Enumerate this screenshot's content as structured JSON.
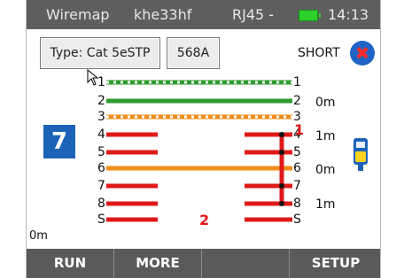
{
  "status_bar": {
    "title": "Wiremap",
    "device": "khe33hf",
    "connector": "RJ45 -",
    "time": "14:13",
    "battery_color": "#2ccf2c"
  },
  "header": {
    "type_button_label": "Type: Cat 5eSTP",
    "scheme_button_label": "568A",
    "result_label": "SHORT",
    "result_icon": "close-circle-icon",
    "result_icon_glyph": "✖"
  },
  "wiremap": {
    "pair_count": "7",
    "left_distance": "0m",
    "remote_icon": "remote-unit-icon",
    "pins_left": [
      "1",
      "2",
      "3",
      "4",
      "5",
      "6",
      "7",
      "8",
      "S"
    ],
    "pins_right": [
      "1",
      "2",
      "3",
      "4",
      "5",
      "6",
      "7",
      "8",
      "S"
    ],
    "wires": [
      {
        "pin": "1",
        "color": "#2e9b2e",
        "style": "dashed-white",
        "status": "ok"
      },
      {
        "pin": "2",
        "color": "#2e9b2e",
        "style": "solid",
        "status": "ok"
      },
      {
        "pin": "3",
        "color": "#f08c1a",
        "style": "dashed-white",
        "status": "ok"
      },
      {
        "pin": "4",
        "color": "#e01818",
        "style": "split",
        "status": "short"
      },
      {
        "pin": "5",
        "color": "#e01818",
        "style": "split",
        "status": "short"
      },
      {
        "pin": "6",
        "color": "#f08c1a",
        "style": "solid",
        "status": "ok"
      },
      {
        "pin": "7",
        "color": "#e01818",
        "style": "split",
        "status": "short"
      },
      {
        "pin": "8",
        "color": "#e01818",
        "style": "split",
        "status": "short"
      },
      {
        "pin": "S",
        "color": "#e01818",
        "style": "split",
        "status": "short"
      }
    ],
    "distances": [
      "0m",
      "1m",
      "0m",
      "1m"
    ],
    "fault_markers": [
      "1",
      "2"
    ]
  },
  "softkeys": [
    "RUN",
    "MORE",
    "",
    "SETUP"
  ]
}
